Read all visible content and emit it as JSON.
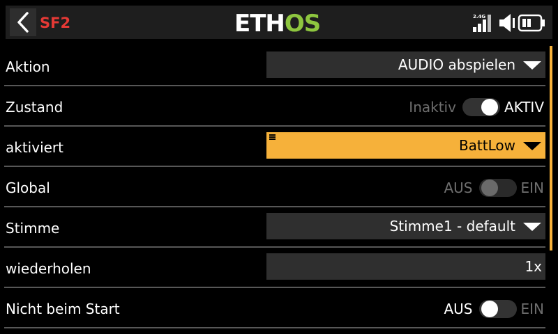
{
  "header": {
    "page_id": "SF2",
    "logo_text": "ETHOS",
    "colors": {
      "accent": "#f6b13a",
      "page_id": "#e53935",
      "logo_green": "#8ec63f"
    },
    "status": {
      "rf_band": "2.4G",
      "signal_icon": "signal-bars-icon",
      "volume_icon": "speaker-icon",
      "battery_icon": "battery-icon"
    }
  },
  "rows": {
    "aktion": {
      "label": "Aktion",
      "value": "AUDIO abspielen"
    },
    "zustand": {
      "label": "Zustand",
      "off_label": "Inaktiv",
      "on_label": "AKTIV",
      "state": "on"
    },
    "aktiviert": {
      "label": "aktiviert",
      "value": "BattLow"
    },
    "global": {
      "label": "Global",
      "off_label": "AUS",
      "on_label": "EIN",
      "state": "off",
      "enabled": false
    },
    "stimme": {
      "label": "Stimme",
      "value": "Stimme1 - default"
    },
    "wiederholen": {
      "label": "wiederholen",
      "value": "1x"
    },
    "nicht_beim_start": {
      "label": "Nicht beim Start",
      "off_label": "AUS",
      "on_label": "EIN",
      "state": "off",
      "enabled": true
    }
  }
}
